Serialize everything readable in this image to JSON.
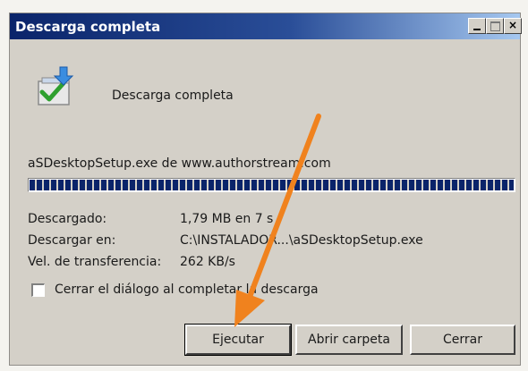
{
  "window": {
    "title": "Descarga completa",
    "controls": {
      "minimize": "_",
      "maximize": "□",
      "close": "×"
    }
  },
  "icon": "download-complete-icon",
  "heading": "Descarga completa",
  "source_line": "aSDesktopSetup.exe de www.authorstream.com",
  "progress": {
    "value_percent": 100
  },
  "details": [
    {
      "label": "Descargado:",
      "value": "1,79 MB en 7 s"
    },
    {
      "label": "Descargar en:",
      "value": "C:\\INSTALADOR...\\aSDesktopSetup.exe"
    },
    {
      "label": "Vel. de transferencia:",
      "value": "262 KB/s"
    }
  ],
  "checkbox": {
    "label": "Cerrar el diálogo al completar la descarga",
    "checked": false
  },
  "buttons": {
    "run": "Ejecutar",
    "open_folder": "Abrir carpeta",
    "close": "Cerrar"
  },
  "colors": {
    "titlebar": "#0a246a",
    "annotation_arrow": "#f0821e"
  }
}
